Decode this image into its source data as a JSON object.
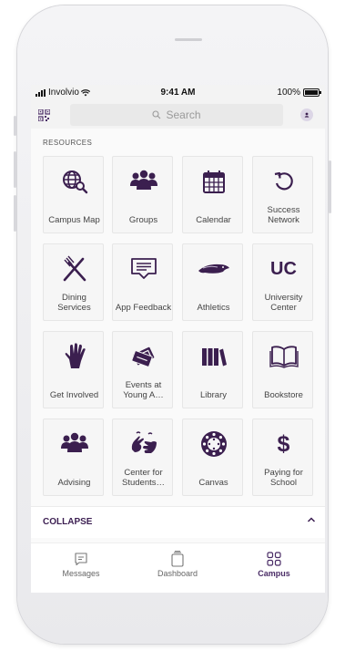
{
  "status": {
    "carrier": "Involvio",
    "time": "9:41 AM",
    "battery": "100%"
  },
  "search": {
    "placeholder": "Search"
  },
  "resources": {
    "label": "RESOURCES",
    "items": [
      {
        "label": "Campus Map",
        "icon": "globe-search-icon"
      },
      {
        "label": "Groups",
        "icon": "people-icon"
      },
      {
        "label": "Calendar",
        "icon": "calendar-icon"
      },
      {
        "label": "Success Network",
        "icon": "refresh-icon"
      },
      {
        "label": "Dining Services",
        "icon": "fork-knife-icon"
      },
      {
        "label": "App Feedback",
        "icon": "feedback-icon"
      },
      {
        "label": "Athletics",
        "icon": "mascot-logo-icon"
      },
      {
        "label": "University Center",
        "icon": "uc-logo-icon",
        "logo_text": "UC"
      },
      {
        "label": "Get Involved",
        "icon": "raised-hand-icon"
      },
      {
        "label": "Events at Young A…",
        "icon": "tickets-icon"
      },
      {
        "label": "Library",
        "icon": "books-icon"
      },
      {
        "label": "Bookstore",
        "icon": "open-book-icon"
      },
      {
        "label": "Advising",
        "icon": "people-icon"
      },
      {
        "label": "Center for Students…",
        "icon": "sign-language-icon"
      },
      {
        "label": "Canvas",
        "icon": "canvas-icon"
      },
      {
        "label": "Paying for School",
        "icon": "dollar-icon",
        "symbol": "$"
      }
    ]
  },
  "collapse": {
    "label": "COLLAPSE"
  },
  "tabs": [
    {
      "label": "Messages",
      "icon": "message-icon"
    },
    {
      "label": "Dashboard",
      "icon": "dashboard-icon"
    },
    {
      "label": "Campus",
      "icon": "grid-icon",
      "active": true
    }
  ],
  "colors": {
    "accent": "#4a2c66",
    "icon": "#3b1f4f",
    "tile": "#f6f6f6"
  }
}
